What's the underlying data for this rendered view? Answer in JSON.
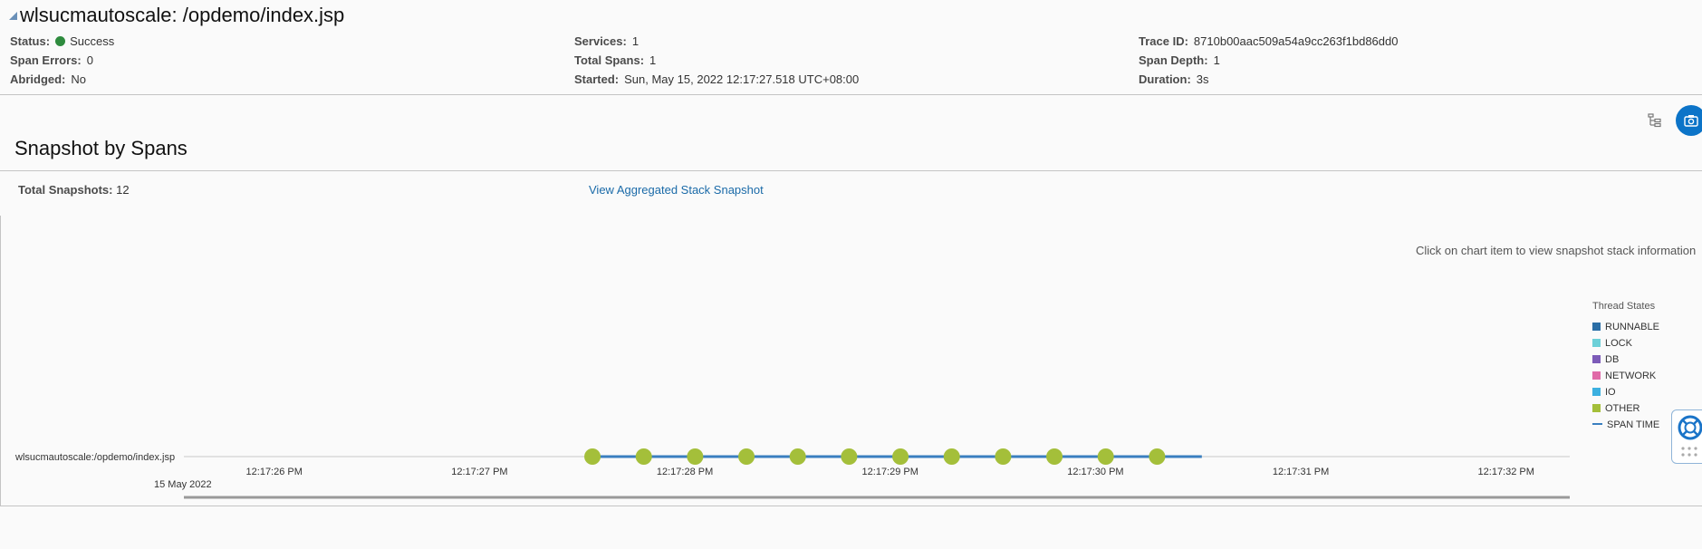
{
  "header": {
    "title": "wlsucmautoscale: /opdemo/index.jsp",
    "col1": [
      {
        "key": "Status:",
        "value": "Success",
        "status_color": "#2e8b3e"
      },
      {
        "key": "Span Errors:",
        "value": "0"
      },
      {
        "key": "Abridged:",
        "value": "No"
      }
    ],
    "col2": [
      {
        "key": "Services:",
        "value": "1"
      },
      {
        "key": "Total Spans:",
        "value": "1"
      },
      {
        "key": "Started:",
        "value": "Sun, May 15, 2022 12:17:27.518 UTC+08:00"
      }
    ],
    "col3": [
      {
        "key": "Trace ID:",
        "value": "8710b00aac509a54a9cc263f1bd86dd0"
      },
      {
        "key": "Span Depth:",
        "value": "1"
      },
      {
        "key": "Duration:",
        "value": "3s"
      }
    ]
  },
  "toolbar": {
    "icons": [
      "tree-view-icon",
      "camera-icon"
    ],
    "accent_color": "#0c74c8"
  },
  "section": {
    "title": "Snapshot by Spans",
    "total_snapshots_label": "Total Snapshots:",
    "total_snapshots_value": "12",
    "aggregated_link": "View Aggregated Stack Snapshot",
    "hint": "Click on chart item to view snapshot stack information"
  },
  "legend": {
    "title": "Thread States",
    "items": [
      {
        "label": "RUNNABLE",
        "color": "#2a6ea6",
        "kind": "square"
      },
      {
        "label": "LOCK",
        "color": "#6cd0d8",
        "kind": "square"
      },
      {
        "label": "DB",
        "color": "#7c5bb8",
        "kind": "square"
      },
      {
        "label": "NETWORK",
        "color": "#e06aa8",
        "kind": "square"
      },
      {
        "label": "IO",
        "color": "#3cb0e0",
        "kind": "square"
      },
      {
        "label": "OTHER",
        "color": "#a4bf3a",
        "kind": "square"
      },
      {
        "label": "SPAN TIME",
        "color": "#3a7fc0",
        "kind": "line"
      }
    ]
  },
  "chart_data": {
    "type": "scatter",
    "row_label": "wlsucmautoscale:/opdemo/index.jsp",
    "date_label": "15 May 2022",
    "x_ticks": [
      "12:17:26 PM",
      "12:17:27 PM",
      "12:17:28 PM",
      "12:17:29 PM",
      "12:17:30 PM",
      "12:17:31 PM",
      "12:17:32 PM"
    ],
    "x_range": [
      "12:17:25.56",
      "12:17:32.31"
    ],
    "span": {
      "start": "12:17:27.518",
      "end": "12:17:30.518",
      "color": "#3a7fc0"
    },
    "snapshots": [
      {
        "time": "12:17:27.55",
        "state": "OTHER"
      },
      {
        "time": "12:17:27.80",
        "state": "OTHER"
      },
      {
        "time": "12:17:28.05",
        "state": "OTHER"
      },
      {
        "time": "12:17:28.30",
        "state": "OTHER"
      },
      {
        "time": "12:17:28.55",
        "state": "OTHER"
      },
      {
        "time": "12:17:28.80",
        "state": "OTHER"
      },
      {
        "time": "12:17:29.05",
        "state": "OTHER"
      },
      {
        "time": "12:17:29.30",
        "state": "OTHER"
      },
      {
        "time": "12:17:29.55",
        "state": "OTHER"
      },
      {
        "time": "12:17:29.80",
        "state": "OTHER"
      },
      {
        "time": "12:17:30.05",
        "state": "OTHER"
      },
      {
        "time": "12:17:30.30",
        "state": "OTHER"
      }
    ],
    "point_color": "#a4bf3a"
  }
}
